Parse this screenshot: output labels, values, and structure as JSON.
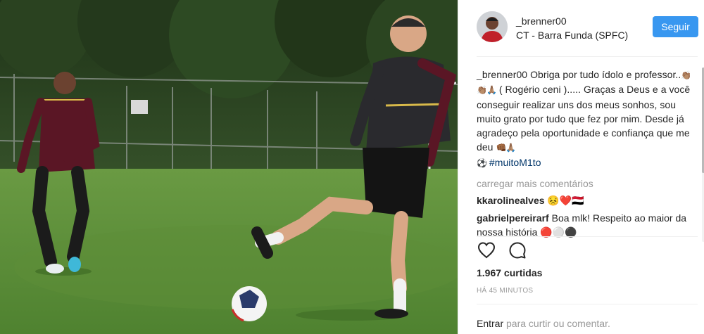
{
  "post": {
    "photo_alt": "",
    "header": {
      "username": "_brenner00",
      "location": "CT - Barra Funda (SPFC)",
      "follow_label": "Seguir"
    },
    "caption": {
      "username": "_brenner00",
      "text_part1": " Obriga por tudo ídolo e professor..",
      "emoji1": "👏🏽👏🏽🙏🏽",
      "text_part2": " ( Rogério ceni )..... Graças a Deus e a você conseguir realizar uns dos meus sonhos, sou muito grato por tudo que fez por mim. Desde já agradeço pela oportunidade e confiança que me deu ",
      "emoji2": "👊🏾🙏🏽",
      "emoji3": "⚽",
      "hashtag": "#muitoM1to"
    },
    "load_more": "carregar mais comentários",
    "comments": [
      {
        "username": "kkarolinealves",
        "text": "😣❤️🇾🇪"
      },
      {
        "username": "gabrielpereirarf",
        "text": "Boa mlk! Respeito ao maior da nossa história 🔴⚪⚫"
      }
    ],
    "icons": {
      "like": "heart-icon",
      "comment": "comment-icon"
    },
    "likes": "1.967 curtidas",
    "time": "HÁ 45 MINUTOS",
    "login": {
      "link": "Entrar",
      "rest": " para curtir ou comentar."
    }
  },
  "colors": {
    "follow_button": "#3897f0",
    "hashtag": "#003569",
    "muted_text": "#999999",
    "divider": "#efefef"
  }
}
